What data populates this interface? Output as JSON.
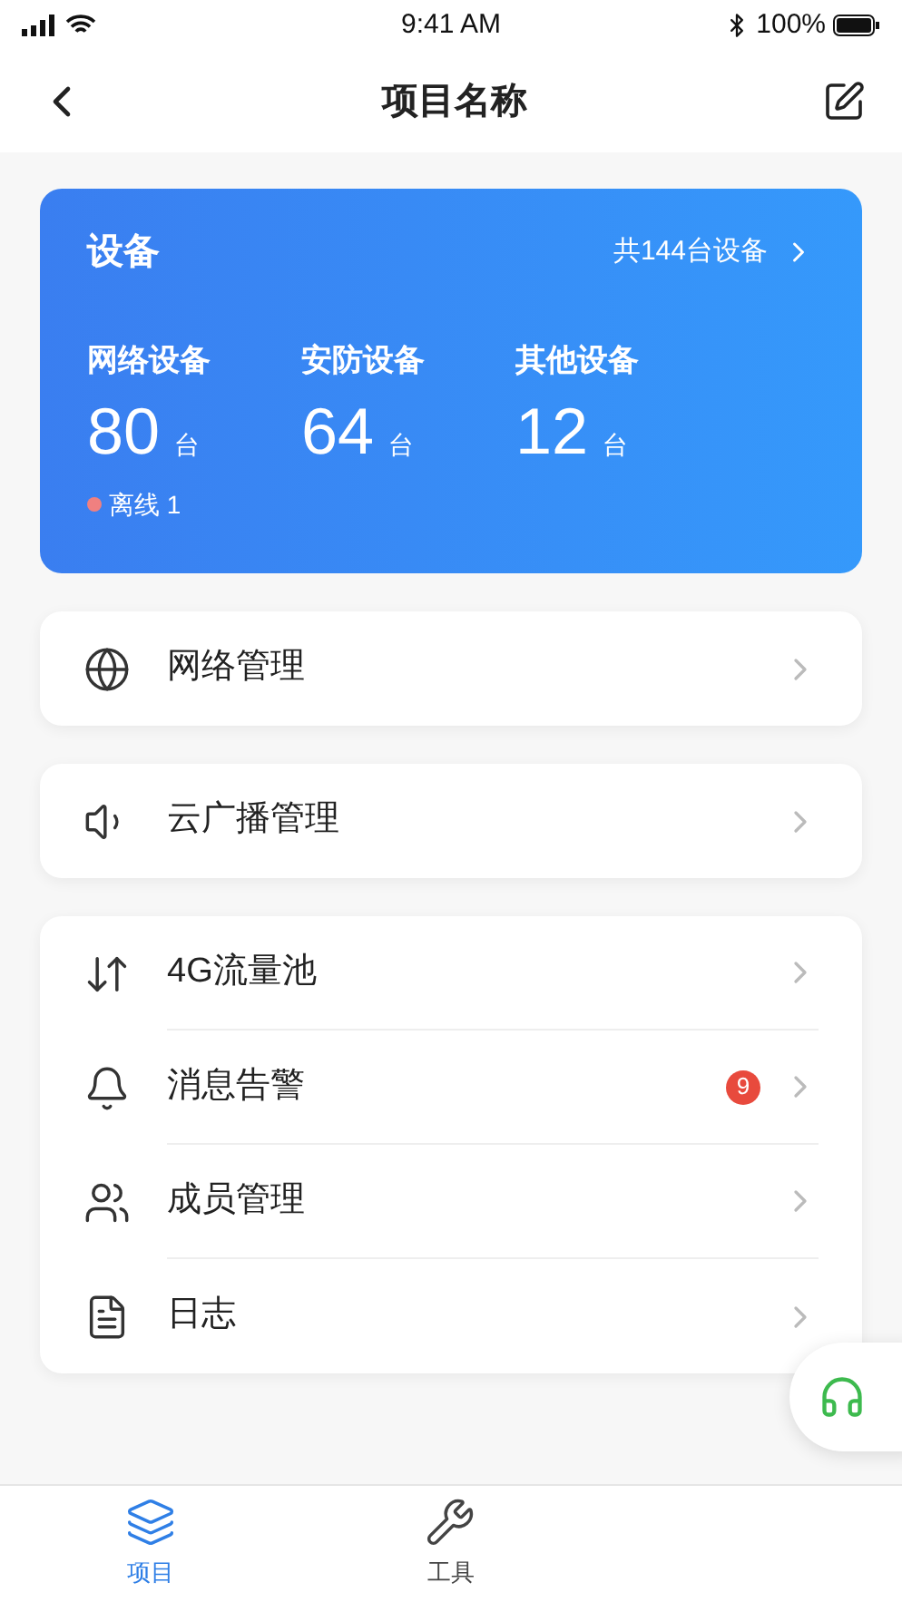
{
  "status_bar": {
    "time": "9:41 AM",
    "battery": "100%"
  },
  "nav": {
    "title": "项目名称"
  },
  "devices": {
    "title": "设备",
    "total": "共144台设备",
    "stats": [
      {
        "label": "网络设备",
        "value": "80",
        "unit": "台",
        "offline": "离线 1"
      },
      {
        "label": "安防设备",
        "value": "64",
        "unit": "台"
      },
      {
        "label": "其他设备",
        "value": "12",
        "unit": "台"
      }
    ]
  },
  "groups": [
    [
      {
        "label": "网络管理"
      }
    ],
    [
      {
        "label": "云广播管理"
      }
    ],
    [
      {
        "label": "4G流量池"
      },
      {
        "label": "消息告警",
        "badge": "9"
      },
      {
        "label": "成员管理"
      },
      {
        "label": "日志"
      }
    ]
  ],
  "tabs": [
    {
      "label": "项目",
      "selected": true
    },
    {
      "label": "工具",
      "selected": false
    }
  ]
}
